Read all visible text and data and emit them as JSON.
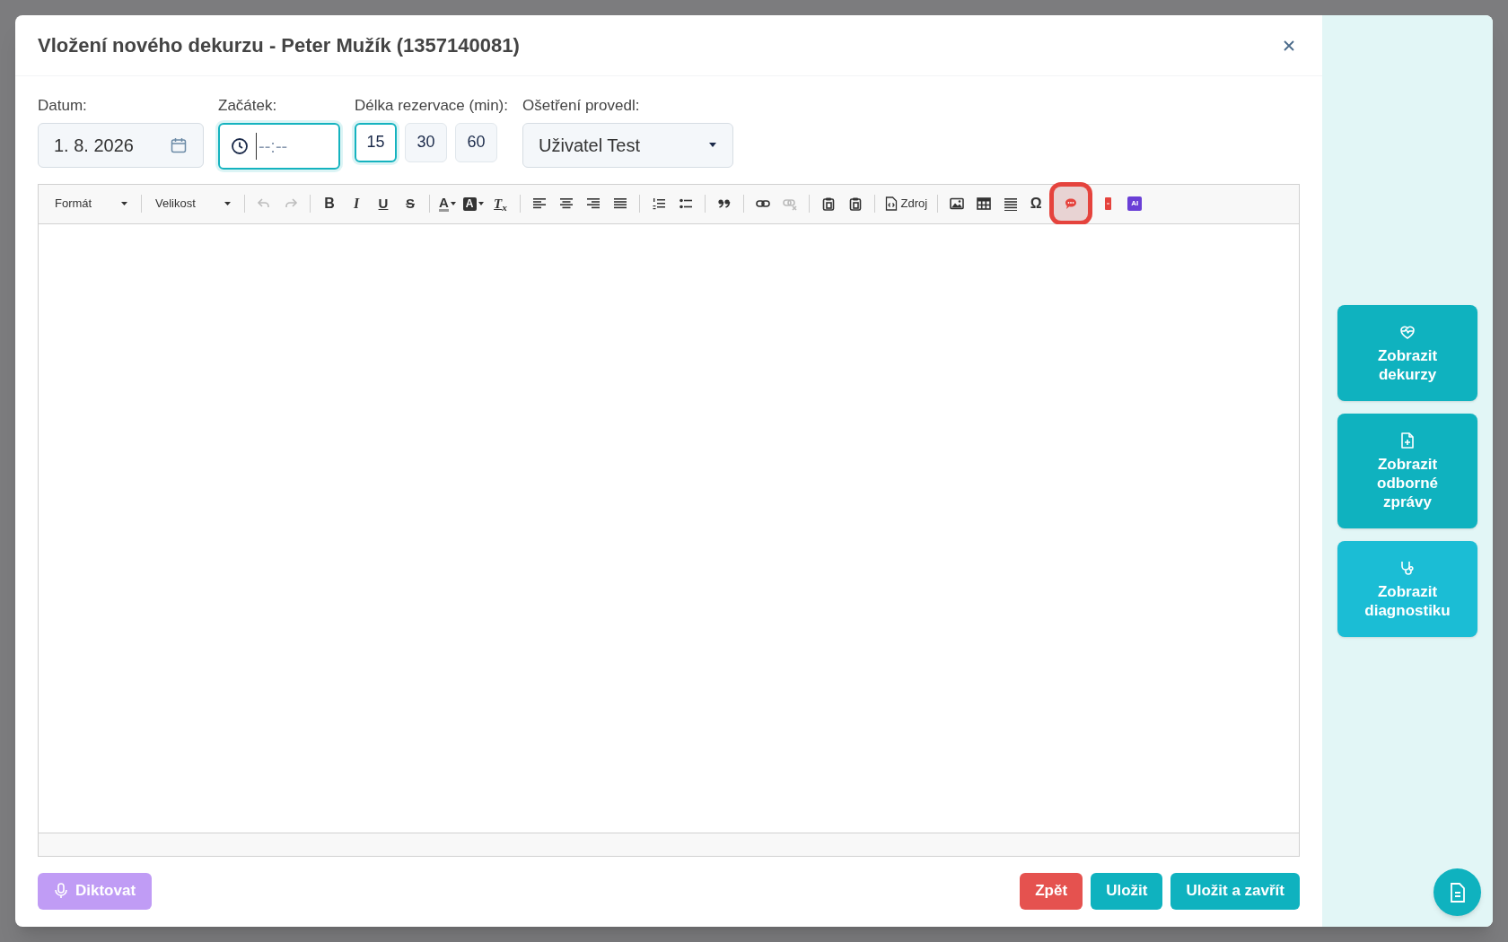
{
  "dialog": {
    "title": "Vložení nového dekurzu - Peter Mužík (1357140081)"
  },
  "fields": {
    "date": {
      "label": "Datum:",
      "value": "1. 8. 2026"
    },
    "start": {
      "label": "Začátek:",
      "placeholder": "--:--",
      "focused": true
    },
    "duration": {
      "label": "Délka rezervace (min):",
      "options": [
        {
          "label": "15",
          "selected": true
        },
        {
          "label": "30",
          "selected": false
        },
        {
          "label": "60",
          "selected": false
        }
      ]
    },
    "performed_by": {
      "label": "Ošetření provedl:",
      "value": "Uživatel Test"
    }
  },
  "toolbar": [
    {
      "kind": "dropdown",
      "label": "Formát"
    },
    {
      "kind": "separator"
    },
    {
      "kind": "dropdown",
      "label": "Velikost"
    },
    {
      "kind": "separator"
    },
    {
      "kind": "icon",
      "disabled": true,
      "highlighted": false
    },
    {
      "kind": "icon",
      "disabled": true,
      "highlighted": false
    },
    {
      "kind": "separator"
    },
    {
      "kind": "bold",
      "label": "B"
    },
    {
      "kind": "italic",
      "label": "I"
    },
    {
      "kind": "underline",
      "label": "U"
    },
    {
      "kind": "strike",
      "label": "S"
    },
    {
      "kind": "separator"
    },
    {
      "kind": "text-color",
      "label": "A"
    },
    {
      "kind": "bg-color",
      "label": "A"
    },
    {
      "kind": "clear-format",
      "label": "T$_{x}$"
    },
    {
      "kind": "separator"
    },
    {
      "kind": "icon",
      "disabled": false,
      "highlighted": false
    },
    {
      "kind": "icon",
      "disabled": false,
      "highlighted": false
    },
    {
      "kind": "icon",
      "disabled": false,
      "highlighted": false
    },
    {
      "kind": "icon",
      "disabled": false,
      "highlighted": false
    },
    {
      "kind": "separator"
    },
    {
      "kind": "icon",
      "disabled": false,
      "highlighted": false
    },
    {
      "kind": "icon",
      "disabled": false,
      "highlighted": false
    },
    {
      "kind": "separator"
    },
    {
      "kind": "icon",
      "disabled": false,
      "highlighted": false
    },
    {
      "kind": "separator"
    },
    {
      "kind": "icon",
      "disabled": false,
      "highlighted": false
    },
    {
      "kind": "icon",
      "disabled": true,
      "highlighted": false
    },
    {
      "kind": "separator"
    },
    {
      "kind": "icon",
      "disabled": false,
      "highlighted": false
    },
    {
      "kind": "icon",
      "disabled": false,
      "highlighted": false
    },
    {
      "kind": "separator"
    },
    {
      "kind": "source",
      "label": "Zdroj"
    },
    {
      "kind": "separator"
    },
    {
      "kind": "icon",
      "disabled": false,
      "highlighted": false
    },
    {
      "kind": "icon",
      "disabled": false,
      "highlighted": false
    },
    {
      "kind": "icon",
      "disabled": false,
      "highlighted": false
    },
    {
      "kind": "symbol",
      "label": "Ω"
    },
    {
      "kind": "icon",
      "disabled": false,
      "highlighted": true
    },
    {
      "kind": "icon",
      "disabled": false,
      "highlighted": false
    },
    {
      "kind": "badge",
      "label": "AI"
    }
  ],
  "footer": {
    "dictate": {
      "label": "Diktovat",
      "disabled": true
    },
    "buttons": [
      {
        "label": "Zpět",
        "kind": "danger"
      },
      {
        "label": "Uložit",
        "kind": "primary"
      },
      {
        "label": "Uložit a zavřít",
        "kind": "primary"
      }
    ]
  },
  "side_panel": {
    "buttons": [
      {
        "label": "Zobrazit dekurzy",
        "kind": "heart"
      },
      {
        "label": "Zobrazit odborné zprávy",
        "kind": "document"
      },
      {
        "label": "Zobrazit diagnostiku",
        "kind": "stethoscope"
      }
    ]
  }
}
